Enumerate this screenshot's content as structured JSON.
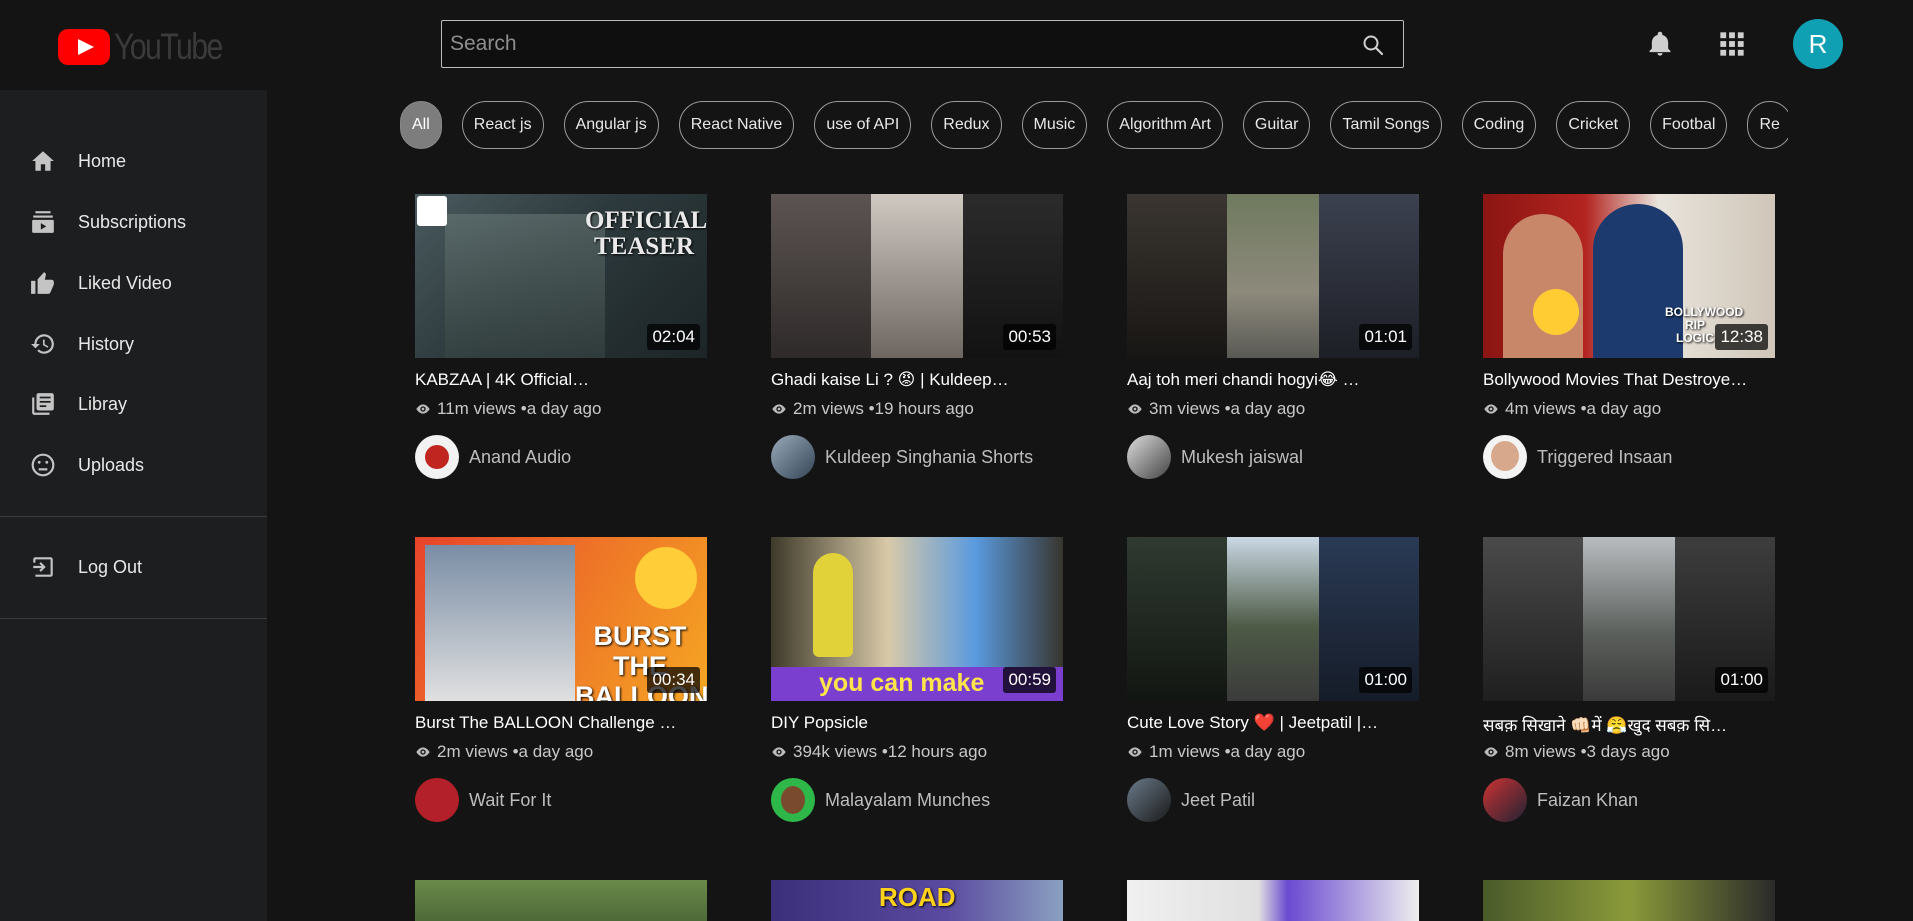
{
  "app": {
    "logo_text": "YouTube",
    "brand_color": "#ff0000",
    "accent": "#10a0b4"
  },
  "search": {
    "placeholder": "Search",
    "value": ""
  },
  "user": {
    "initial": "R"
  },
  "sidebar": {
    "items": [
      {
        "label": "Home",
        "icon": "home-icon"
      },
      {
        "label": "Subscriptions",
        "icon": "subscriptions-icon"
      },
      {
        "label": "Liked Video",
        "icon": "thumbs-up-icon"
      },
      {
        "label": "History",
        "icon": "history-icon"
      },
      {
        "label": "Libray",
        "icon": "library-icon"
      },
      {
        "label": "Uploads",
        "icon": "uploads-icon"
      }
    ],
    "logout": {
      "label": "Log Out",
      "icon": "logout-icon"
    }
  },
  "chips": [
    "All",
    "React js",
    "Angular js",
    "React Native",
    "use of API",
    "Redux",
    "Music",
    "Algorithm Art",
    "Guitar",
    "Tamil Songs",
    "Coding",
    "Cricket",
    "Footbal",
    "Re"
  ],
  "videos": [
    {
      "title": "KABZAA | 4K Official…",
      "views": "11m views",
      "age": "•a day ago",
      "channel": "Anand Audio",
      "duration": "02:04",
      "thumb_text": "OFFICIAL TEASER"
    },
    {
      "title": "Ghadi kaise Li ? 😡 | Kuldeep…",
      "views": "2m views",
      "age": "•19 hours ago",
      "channel": "Kuldeep Singhania Shorts",
      "duration": "00:53",
      "thumb_text": ""
    },
    {
      "title": "Aaj toh meri chandi hogyi😂 …",
      "views": "3m views",
      "age": "•a day ago",
      "channel": "Mukesh jaiswal",
      "duration": "01:01",
      "thumb_text": ""
    },
    {
      "title": "Bollywood Movies That Destroye…",
      "views": "4m views",
      "age": "•a day ago",
      "channel": "Triggered Insaan",
      "duration": "12:38",
      "thumb_text": "BOLLYWOOD RIP LOGIC"
    },
    {
      "title": "Burst The BALLOON Challenge …",
      "views": "2m views",
      "age": "•a day ago",
      "channel": "Wait For It",
      "duration": "00:34",
      "thumb_text": "BURST THE BALLOON"
    },
    {
      "title": "DIY Popsicle",
      "views": "394k views",
      "age": "•12 hours ago",
      "channel": "Malayalam Munches",
      "duration": "00:59",
      "thumb_text": "you can make"
    },
    {
      "title": "Cute Love Story ❤️ | Jeetpatil |…",
      "views": "1m views",
      "age": "•a day ago",
      "channel": "Jeet Patil",
      "duration": "01:00",
      "thumb_text": ""
    },
    {
      "title": "सबक़ सिखाने 👊🏻में 😤खुद सबक़ सि…",
      "views": "8m views",
      "age": "•3 days ago",
      "channel": "Faizan Khan",
      "duration": "01:00",
      "thumb_text": ""
    },
    {
      "title": "",
      "views": "",
      "age": "",
      "channel": "",
      "duration": "",
      "thumb_text": ""
    },
    {
      "title": "",
      "views": "",
      "age": "",
      "channel": "",
      "duration": "",
      "thumb_text": "ROAD"
    },
    {
      "title": "",
      "views": "",
      "age": "",
      "channel": "",
      "duration": "",
      "thumb_text": ""
    },
    {
      "title": "",
      "views": "",
      "age": "",
      "channel": "",
      "duration": "",
      "thumb_text": ""
    }
  ]
}
